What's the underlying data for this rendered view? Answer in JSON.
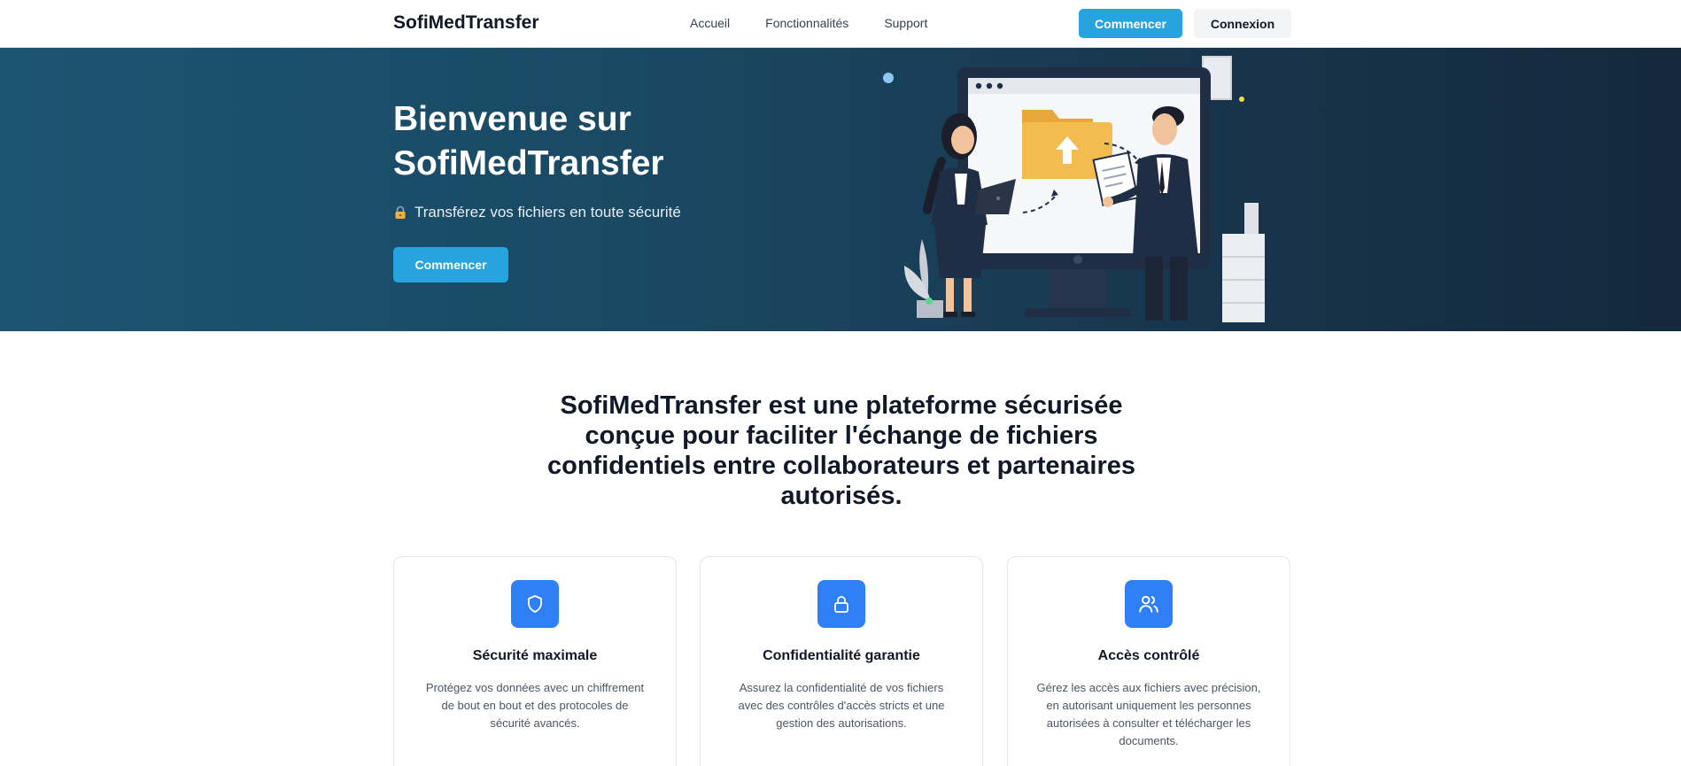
{
  "nav": {
    "brand": "SofiMedTransfer",
    "links": [
      "Accueil",
      "Fonctionnalités",
      "Support"
    ],
    "start_label": "Commencer",
    "login_label": "Connexion"
  },
  "hero": {
    "title": "Bienvenue sur SofiMedTransfer",
    "subtitle": "Transférez vos fichiers en toute sécurité",
    "subtitle_icon": "lock-icon",
    "cta_label": "Commencer"
  },
  "intro": {
    "text": "SofiMedTransfer est une plateforme sécurisée conçue pour faciliter l'échange de fichiers confidentiels entre collaborateurs et partenaires autorisés."
  },
  "features": [
    {
      "icon": "shield-icon",
      "title": "Sécurité maximale",
      "text": "Protégez vos données avec un chiffrement de bout en bout et des protocoles de sécurité avancés."
    },
    {
      "icon": "lock-icon",
      "title": "Confidentialité garantie",
      "text": "Assurez la confidentialité de vos fichiers avec des contrôles d'accès stricts et une gestion des autorisations."
    },
    {
      "icon": "users-icon",
      "title": "Accès contrôlé",
      "text": "Gérez les accès aux fichiers avec précision, en autorisant uniquement les personnes autorisées à consulter et télécharger les documents."
    }
  ],
  "colors": {
    "primary": "#27a4dd",
    "feature_icon_bg": "#2f80f6",
    "hero_gradient_start": "#1c5572",
    "hero_gradient_end": "#14293b"
  }
}
